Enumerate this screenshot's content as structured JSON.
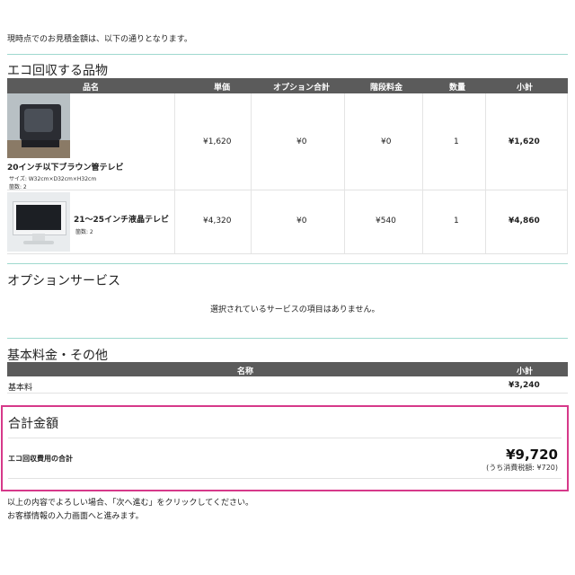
{
  "intro": "現時点でのお見積金額は、以下の通りとなります。",
  "eco": {
    "title": "エコ回収する品物",
    "headers": [
      "品名",
      "単価",
      "オプション合計",
      "階段料金",
      "数量",
      "小計"
    ],
    "items": [
      {
        "name": "20インチ以下ブラウン管テレビ",
        "size": "サイズ: W32cm×D32cm×H32cm",
        "count": "箇数: 2",
        "unit_price": "¥1,620",
        "option_total": "¥0",
        "stairs_fee": "¥0",
        "qty": "1",
        "subtotal": "¥1,620"
      },
      {
        "name": "21〜25インチ液晶テレビ",
        "count": "箇数: 2",
        "unit_price": "¥4,320",
        "option_total": "¥0",
        "stairs_fee": "¥540",
        "qty": "1",
        "subtotal": "¥4,860"
      }
    ]
  },
  "options": {
    "title": "オプションサービス",
    "empty_message": "選択されているサービスの項目はありません。"
  },
  "basic": {
    "title": "基本料金・その他",
    "headers": [
      "名称",
      "小計"
    ],
    "rows": [
      {
        "name": "基本料",
        "subtotal": "¥3,240"
      }
    ]
  },
  "total": {
    "title": "合計金額",
    "label": "エコ回収費用の合計",
    "amount": "¥9,720",
    "tax_note": "(うち消費税額: ¥720)"
  },
  "footer": {
    "line1": "以上の内容でよろしい場合、「次へ進む」をクリックしてください。",
    "line2": "お客様情報の入力画面へと進みます。"
  },
  "colors": {
    "header_bg": "#5b5b5b",
    "section_rule": "#9fd9cf",
    "total_border": "#d6398a"
  }
}
